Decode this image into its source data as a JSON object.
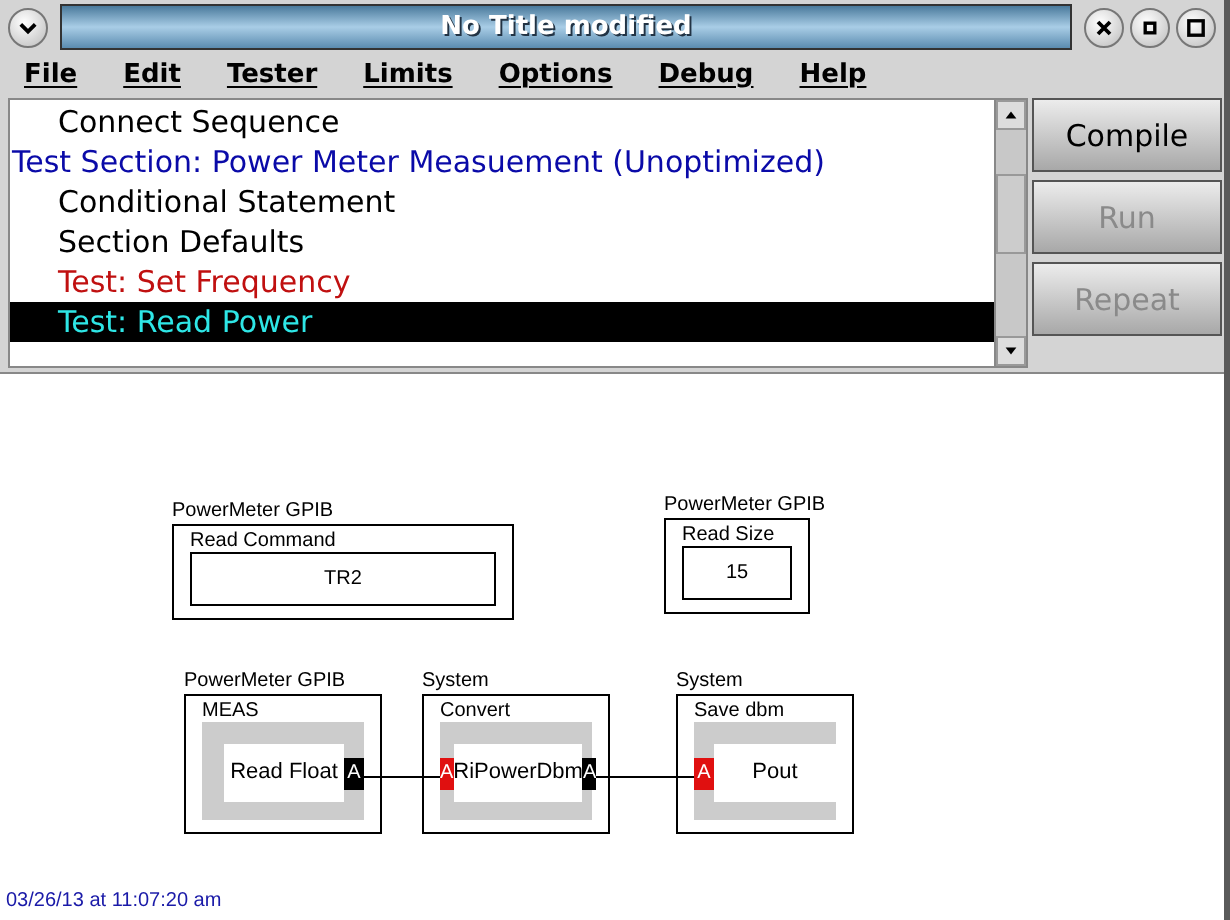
{
  "window": {
    "title": "No Title  modified"
  },
  "menu": [
    "File",
    "Edit",
    "Tester",
    "Limits",
    "Options",
    "Debug",
    "Help"
  ],
  "sequence": [
    {
      "text": "Connect Sequence",
      "kind": "step",
      "selected": false
    },
    {
      "text": "Test Section: Power Meter Measuement (Unoptimized)",
      "kind": "section",
      "selected": false
    },
    {
      "text": "Conditional Statement",
      "kind": "step",
      "selected": false
    },
    {
      "text": "Section Defaults",
      "kind": "step",
      "selected": false
    },
    {
      "text": "Test: Set Frequency",
      "kind": "test",
      "selected": false
    },
    {
      "text": "Test: Read Power",
      "kind": "test",
      "selected": true
    }
  ],
  "buttons": [
    {
      "label": "Compile",
      "disabled": false
    },
    {
      "label": "Run",
      "disabled": true
    },
    {
      "label": "Repeat",
      "disabled": true
    }
  ],
  "diagram": {
    "nodes": [
      {
        "category": "PowerMeter GPIB",
        "name": "Read Command",
        "kind": "field",
        "value": "TR2"
      },
      {
        "category": "PowerMeter GPIB",
        "name": "Read Size",
        "kind": "field",
        "value": "15"
      },
      {
        "category": "PowerMeter GPIB",
        "name": "MEAS",
        "kind": "block",
        "value": "Read Float",
        "ports": [
          {
            "kind": "out",
            "label": "A"
          }
        ]
      },
      {
        "category": "System",
        "name": "Convert",
        "kind": "block",
        "value": "RiPowerDbm",
        "ports": [
          {
            "kind": "in",
            "label": "A"
          },
          {
            "kind": "out",
            "label": "A"
          }
        ]
      },
      {
        "category": "System",
        "name": "Save dbm",
        "kind": "block",
        "value": "Pout",
        "ports": [
          {
            "kind": "in",
            "label": "A"
          }
        ]
      }
    ]
  },
  "status": "03/26/13 at 11:07:20 am"
}
